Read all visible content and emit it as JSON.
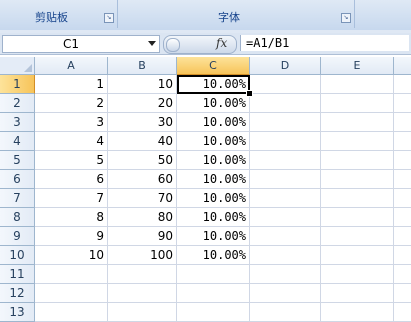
{
  "ribbon": {
    "groups": [
      {
        "label": "剪贴板"
      },
      {
        "label": "字体"
      }
    ]
  },
  "formula_bar": {
    "name_box": "C1",
    "fx_label": "fx",
    "formula": "=A1/B1"
  },
  "sheet": {
    "columns": [
      "A",
      "B",
      "C",
      "D",
      "E"
    ],
    "selected_column": "C",
    "selected_row": "1",
    "active_cell": "C1",
    "rows": [
      {
        "n": "1",
        "a": "1",
        "b": "10",
        "c": "10.00%"
      },
      {
        "n": "2",
        "a": "2",
        "b": "20",
        "c": "10.00%"
      },
      {
        "n": "3",
        "a": "3",
        "b": "30",
        "c": "10.00%"
      },
      {
        "n": "4",
        "a": "4",
        "b": "40",
        "c": "10.00%"
      },
      {
        "n": "5",
        "a": "5",
        "b": "50",
        "c": "10.00%"
      },
      {
        "n": "6",
        "a": "6",
        "b": "60",
        "c": "10.00%"
      },
      {
        "n": "7",
        "a": "7",
        "b": "70",
        "c": "10.00%"
      },
      {
        "n": "8",
        "a": "8",
        "b": "80",
        "c": "10.00%"
      },
      {
        "n": "9",
        "a": "9",
        "b": "90",
        "c": "10.00%"
      },
      {
        "n": "10",
        "a": "10",
        "b": "100",
        "c": "10.00%"
      },
      {
        "n": "11",
        "a": "",
        "b": "",
        "c": ""
      },
      {
        "n": "12",
        "a": "",
        "b": "",
        "c": ""
      },
      {
        "n": "13",
        "a": "",
        "b": "",
        "c": ""
      }
    ]
  },
  "colors": {
    "ribbon_label": "#15428b",
    "selected_header": "#f7c45a",
    "grid_line": "#d0d7e5",
    "header_border": "#9eb6ce"
  }
}
